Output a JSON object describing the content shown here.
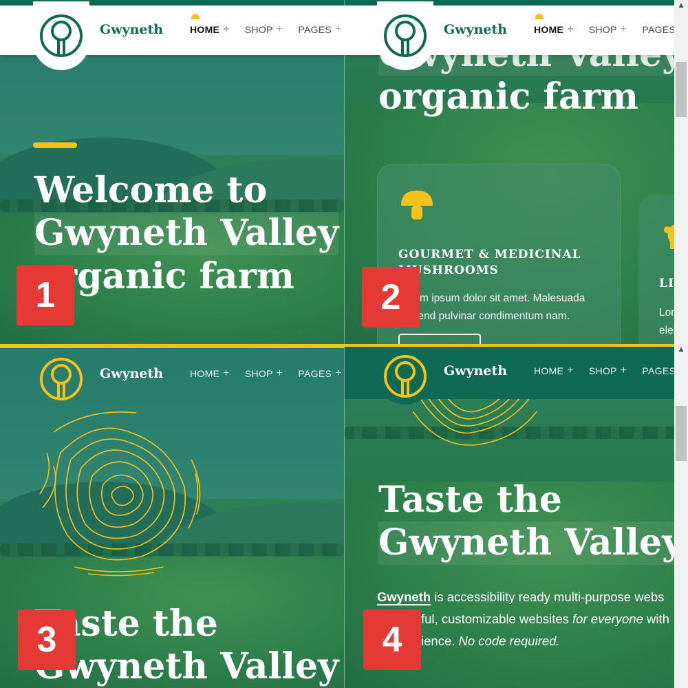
{
  "colors": {
    "brand_green": "#0e6a53",
    "accent_yellow": "#f5c21b",
    "badge_red": "#e53935"
  },
  "brand": {
    "name": "Gwyneth",
    "logo_icon": "tree-icon"
  },
  "nav": {
    "items": [
      "HOME",
      "SHOP",
      "PAGES"
    ],
    "active": "HOME",
    "plus_glyph": "+"
  },
  "hero": {
    "q1_lines": [
      "Welcome to",
      "Gwyneth Valley",
      "organic farm"
    ],
    "q2_line": "organic farm",
    "q2_partial": "Gwyneth Valley",
    "q3_lines": [
      "Taste the",
      "Gwyneth Valley"
    ],
    "q4_lines": [
      "Taste the",
      "Gwyneth Valley"
    ]
  },
  "cards": [
    {
      "icon": "mushroom-icon",
      "title_line1": "GOURMET & MEDICINAL",
      "title_line2": "MUSHROOMS",
      "text_line1": "Lorem ipsum dolor sit amet. Malesuada",
      "text_line2": "eleifend pulvinar condimentum nam."
    },
    {
      "icon": "livestock-icon",
      "title": "LIVE",
      "text_line1": "Lorem",
      "text_line2": "eleifer"
    }
  ],
  "intro": {
    "brand": "Gwyneth",
    "line1_rest": " is accessibility ready multi-purpose webs",
    "line2_start": "ful, customizable websites ",
    "line2_em": "for everyone",
    "line2_end": " with",
    "line3_start": "ience. ",
    "line3_em": "No code required."
  },
  "badges": [
    "1",
    "2",
    "3",
    "4"
  ]
}
